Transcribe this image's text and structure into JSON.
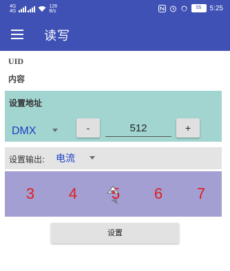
{
  "status_bar": {
    "left_top": "4G",
    "left_bottom": "4G",
    "net_speed_value": "128",
    "net_speed_unit": "B/s",
    "battery": "55",
    "time": "5:25",
    "icons": [
      "sim-icon",
      "signal-icon",
      "wifi-icon",
      "nfc-icon",
      "alarm-icon",
      "sync-icon",
      "battery-icon"
    ]
  },
  "app_bar": {
    "title": "读写",
    "menu_icon": "hamburger-menu-icon"
  },
  "fields": {
    "uid_label": "UID",
    "content_label": "内容"
  },
  "address": {
    "title": "设置地址",
    "protocol_selected": "DMX",
    "minus_label": "-",
    "plus_label": "+",
    "value": "512"
  },
  "output": {
    "label": "设置输出:",
    "selected": "电流"
  },
  "picker": {
    "numbers": [
      "3",
      "4",
      "5",
      "6",
      "7"
    ],
    "selected": "5",
    "number_color": "#e01d1d",
    "background": "#a39fd3"
  },
  "action": {
    "set_label": "设置"
  },
  "colors": {
    "primary": "#3f51b5",
    "address_panel": "#a2d5d0",
    "accent_text": "#1a3fc5"
  }
}
